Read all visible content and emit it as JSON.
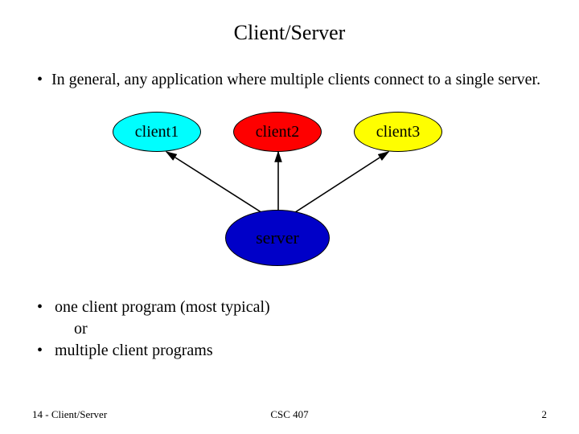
{
  "title": "Client/Server",
  "bullet1_prefix": "•",
  "bullet1_text": "In general, any application where multiple clients connect to a single server.",
  "diagram": {
    "client1": "client1",
    "client2": "client2",
    "client3": "client3",
    "server": "server"
  },
  "bullet2_prefix": "•",
  "bullet2_text": "one client program (most typical)",
  "bullet2_or": "or",
  "bullet3_prefix": "•",
  "bullet3_text": "multiple client programs",
  "footer": {
    "left": "14 - Client/Server",
    "center": "CSC 407",
    "right": "2"
  }
}
